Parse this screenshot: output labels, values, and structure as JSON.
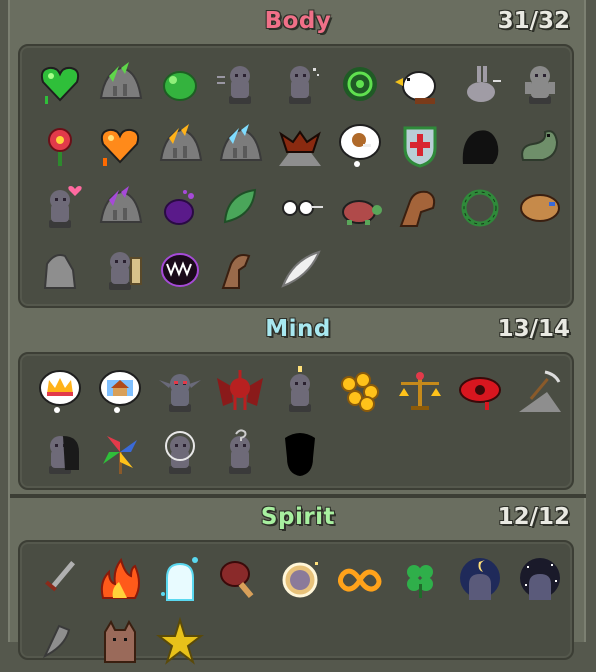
{
  "sections": {
    "body": {
      "title": "Body",
      "count": "31/32",
      "title_color": "#f07088",
      "icons": [
        "green-heart-icon",
        "green-cave-icon",
        "green-fruit-icon",
        "dash-statue-icon",
        "sparkle-statue-icon",
        "green-spiral-icon",
        "eagle-icon",
        "rabbit-icon",
        "gray-statue-icon",
        "red-flower-icon",
        "orange-heart-icon",
        "orange-cave-icon",
        "blue-cave-icon",
        "bat-mountain-icon",
        "meat-thought-icon",
        "shield-cross-icon",
        "shadow-creature-icon",
        "green-snake-icon",
        "heart-statue-icon",
        "purple-cave-icon",
        "purple-blob-icon",
        "green-leaf-icon",
        "glasses-icon",
        "turtle-icon",
        "arm-muscle-icon",
        "vine-ring-icon",
        "tan-fist-icon",
        "rock-icon",
        "door-statue-icon",
        "fanged-mouth-icon",
        "brown-arm-icon",
        "white-feather-icon"
      ]
    },
    "mind": {
      "title": "Mind",
      "count": "13/14",
      "title_color": "#a8e8f0",
      "icons": [
        "crown-thought-icon",
        "house-thought-icon",
        "goblin-icon",
        "red-demon-icon",
        "candle-statue-icon",
        "gold-coins-icon",
        "balance-scale-icon",
        "red-eye-icon",
        "pickaxe-icon",
        "shadow-statue-icon",
        "pinwheel-icon",
        "halo-statue-icon",
        "question-statue-icon",
        "locked-silhouette-icon"
      ]
    },
    "spirit": {
      "title": "Spirit",
      "count": "12/12",
      "title_color": "#a8f0a0",
      "icons": [
        "sword-icon",
        "fire-icon",
        "ice-ghost-icon",
        "drumstick-icon",
        "sun-face-icon",
        "infinity-icon",
        "clover-icon",
        "moon-ghost-icon",
        "star-ghost-icon",
        "gray-axe-icon",
        "cat-icon",
        "gold-star-icon"
      ]
    }
  }
}
